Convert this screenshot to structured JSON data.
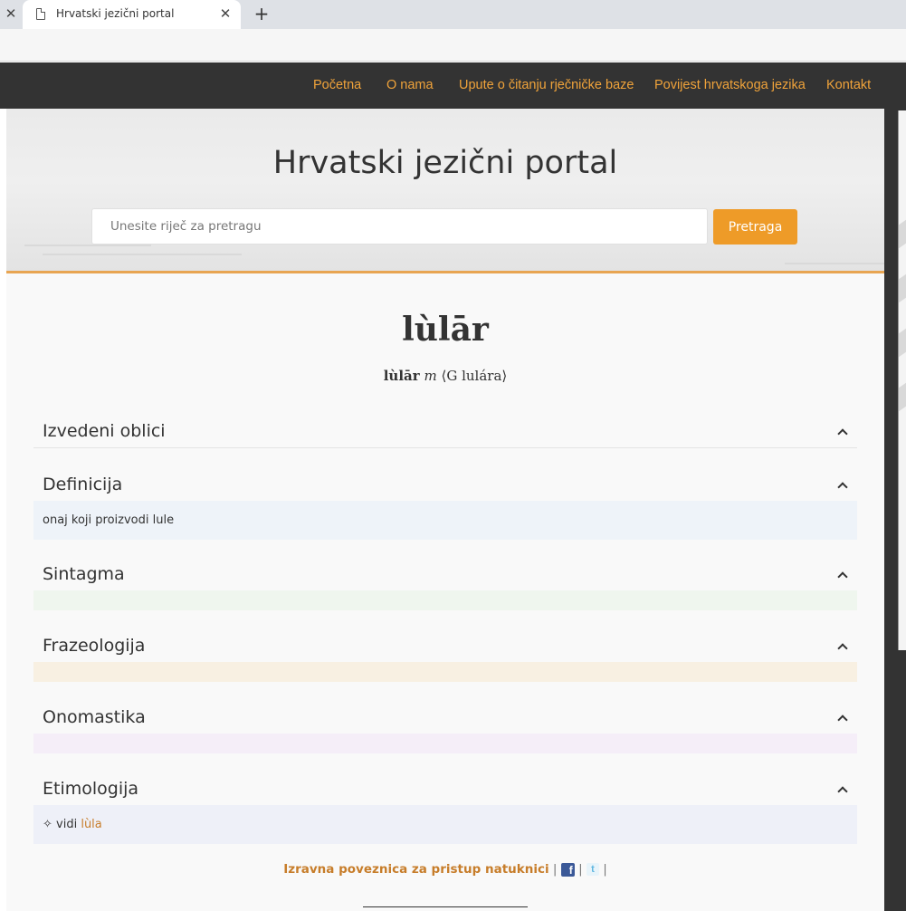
{
  "browser": {
    "tab_title": "Hrvatski jezični portal",
    "tab_close_glyph": "✕",
    "prev_tab_close_glyph": "✕",
    "new_tab_glyph": "+"
  },
  "nav": {
    "items": [
      {
        "label": "Početna"
      },
      {
        "label": "O nama"
      },
      {
        "label": "Upute o čitanju rječničke baze"
      },
      {
        "label": "Povijest hrvatskoga jezika"
      },
      {
        "label": "Kontakt"
      }
    ]
  },
  "header": {
    "title": "Hrvatski jezični portal",
    "search_placeholder": "Unesite riječ za pretragu",
    "search_value": "",
    "search_button": "Pretraga"
  },
  "entry": {
    "headword": "lùlār",
    "grammar_word": "lùlār",
    "grammar_pos": "m",
    "grammar_rest": "⟨G lulára⟩"
  },
  "sections": [
    {
      "title": "Izvedeni oblici",
      "text": "",
      "color": "#f9f9f9"
    },
    {
      "title": "Definicija",
      "text": "onaj koji proizvodi lule",
      "color": "#eef3f9"
    },
    {
      "title": "Sintagma",
      "text": "",
      "color": "#eff6ee"
    },
    {
      "title": "Frazeologija",
      "text": "",
      "color": "#f8f0e2"
    },
    {
      "title": "Onomastika",
      "text": "",
      "color": "#f5eef8"
    },
    {
      "title": "Etimologija",
      "text_prefix": "✧ vidi ",
      "link": "lùla",
      "color": "#eef0f8"
    }
  ],
  "footer": {
    "permalink_label": "Izravna poveznica za pristup natuknici",
    "separator": "|",
    "facebook_glyph": "f",
    "twitter_glyph": "t"
  }
}
